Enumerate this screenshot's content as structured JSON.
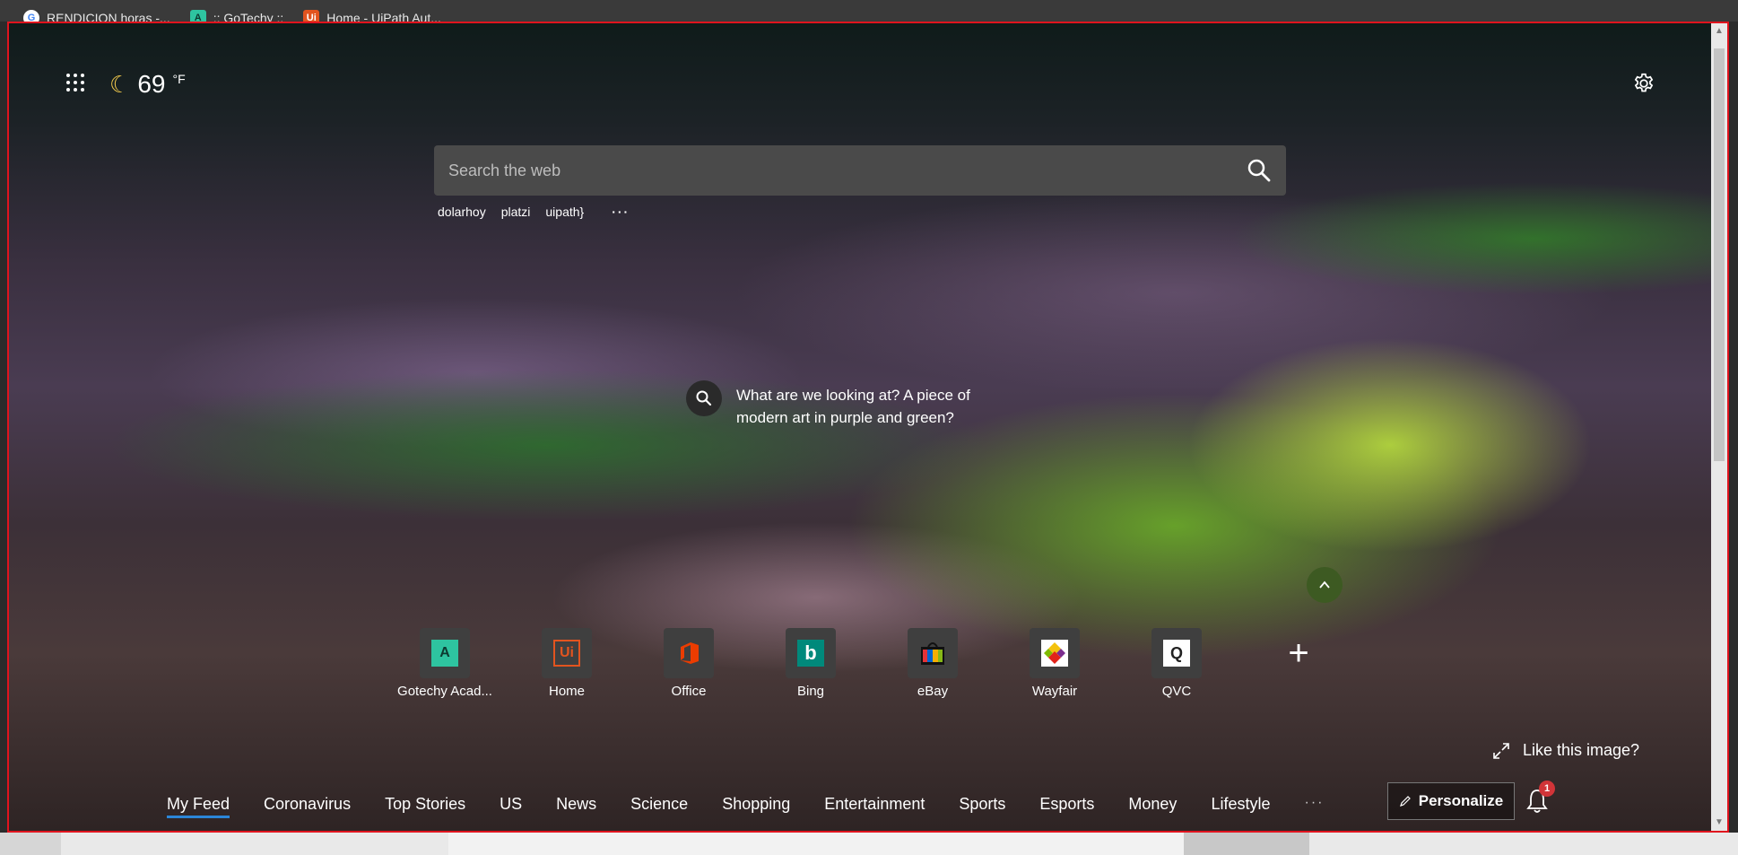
{
  "bookmarks": [
    {
      "label": "RENDICION horas -...",
      "icon": "google-icon"
    },
    {
      "label": ":: GoTechy ::",
      "icon": "gotechy-icon"
    },
    {
      "label": "Home - UiPath Aut...",
      "icon": "uipath-icon"
    }
  ],
  "weather": {
    "temperature": "69",
    "unit": "°F",
    "icon": "moon-icon"
  },
  "search": {
    "placeholder": "Search the web"
  },
  "suggestions": [
    "dolarhoy",
    "platzi",
    "uipath}",
    "···"
  ],
  "image_info": {
    "caption": "What are we looking at? A piece of modern art in purple and green?"
  },
  "quick_links": [
    {
      "label": "Gotechy Acad...",
      "icon": "gotechy-icon"
    },
    {
      "label": "Home",
      "icon": "uipath-icon"
    },
    {
      "label": "Office",
      "icon": "office-icon"
    },
    {
      "label": "Bing",
      "icon": "bing-icon"
    },
    {
      "label": "eBay",
      "icon": "ebay-icon"
    },
    {
      "label": "Wayfair",
      "icon": "wayfair-icon"
    },
    {
      "label": "QVC",
      "icon": "qvc-icon"
    }
  ],
  "like_image": {
    "label": "Like this image?"
  },
  "feed_nav": {
    "items": [
      "My Feed",
      "Coronavirus",
      "Top Stories",
      "US",
      "News",
      "Science",
      "Shopping",
      "Entertainment",
      "Sports",
      "Esports",
      "Money",
      "Lifestyle"
    ],
    "more": "···",
    "active": "My Feed"
  },
  "personalize": {
    "label": "Personalize"
  },
  "notifications": {
    "count": "1"
  },
  "colors": {
    "accent": "#2b86d8",
    "border": "#e0141e",
    "badge": "#d13438"
  }
}
